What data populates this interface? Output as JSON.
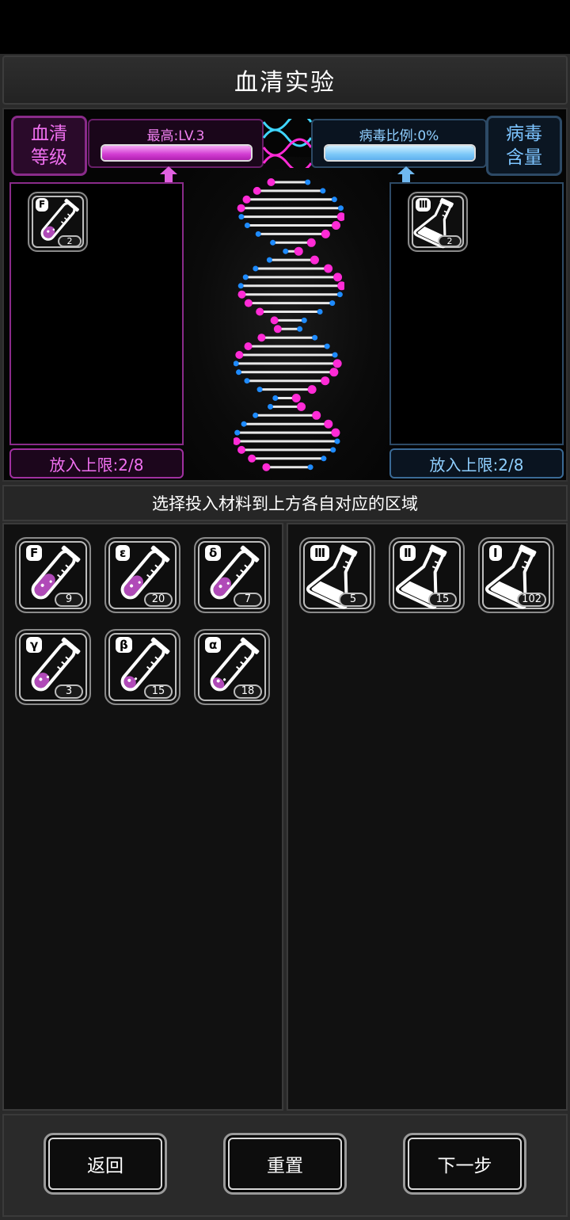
{
  "title": "血清实验",
  "serum": {
    "label_line1": "血清",
    "label_line2": "等级",
    "gauge_text": "最高:LV.3",
    "gauge_fill": 1.0,
    "limit": "放入上限:2/8",
    "placed": [
      {
        "icon": "test-tube-icon",
        "tag": "F",
        "count": "2",
        "fill": 0.35
      }
    ]
  },
  "virus": {
    "label_line1": "病毒",
    "label_line2": "含量",
    "gauge_text": "病毒比例:0%",
    "gauge_fill": 1.0,
    "limit": "放入上限:2/8",
    "placed": [
      {
        "icon": "flask-icon",
        "tag": "Ⅲ",
        "count": "2"
      }
    ]
  },
  "hint": "选择投入材料到上方各自对应的区域",
  "inventory_left": [
    {
      "icon": "test-tube-icon",
      "tag": "F",
      "count": "9",
      "fill": 0.55
    },
    {
      "icon": "test-tube-icon",
      "tag": "ε",
      "count": "20",
      "fill": 0.5
    },
    {
      "icon": "test-tube-icon",
      "tag": "δ",
      "count": "7",
      "fill": 0.45
    },
    {
      "icon": "test-tube-icon",
      "tag": "γ",
      "count": "3",
      "fill": 0.35
    },
    {
      "icon": "test-tube-icon",
      "tag": "β",
      "count": "15",
      "fill": 0.25
    },
    {
      "icon": "test-tube-icon",
      "tag": "α",
      "count": "18",
      "fill": 0.2
    }
  ],
  "inventory_right": [
    {
      "icon": "flask-icon",
      "tag": "Ⅲ",
      "count": "5"
    },
    {
      "icon": "flask-icon",
      "tag": "Ⅱ",
      "count": "15"
    },
    {
      "icon": "flask-icon",
      "tag": "Ⅰ",
      "count": "102"
    }
  ],
  "buttons": {
    "back": "返回",
    "reset": "重置",
    "next": "下一步"
  },
  "colors": {
    "serum_accent": "#d23cd2",
    "virus_accent": "#6fb8f0",
    "helix_pink": "#ff2bd6",
    "helix_blue": "#1e8bff"
  }
}
